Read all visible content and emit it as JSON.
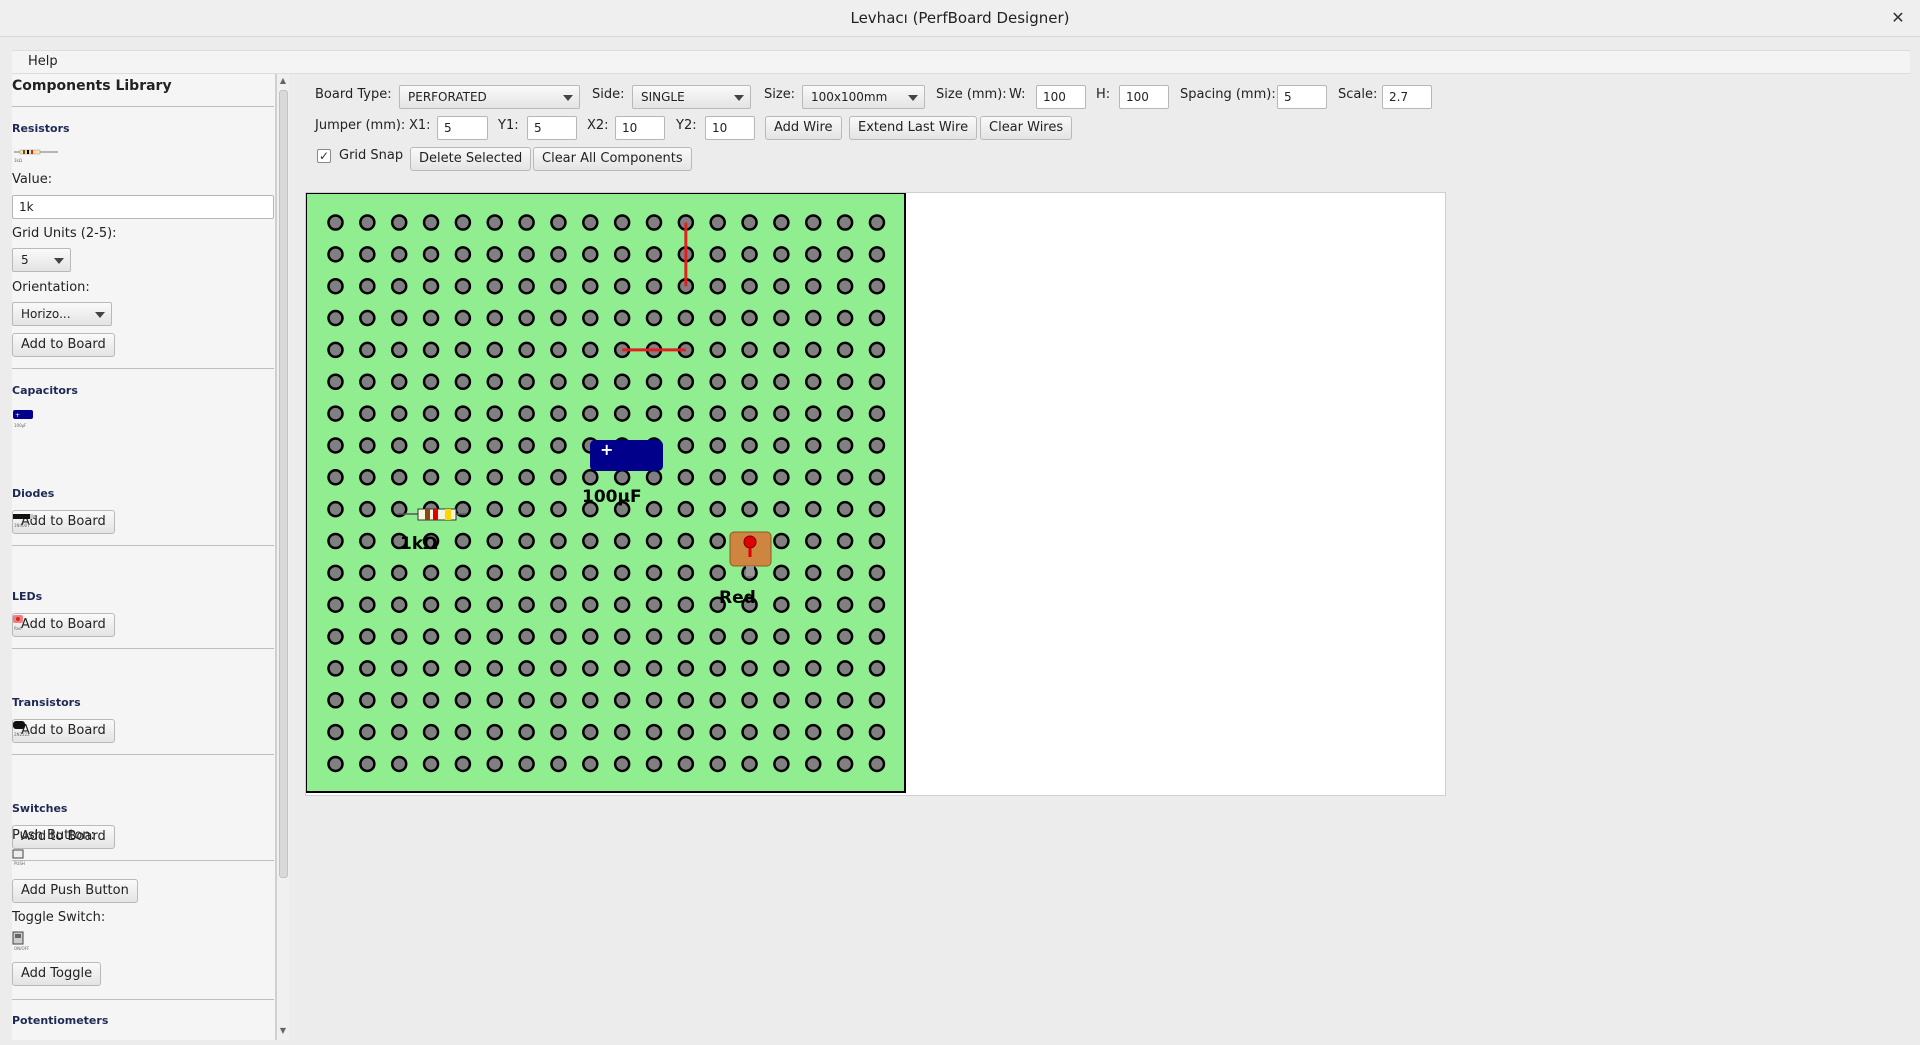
{
  "window": {
    "title": "Levhacı (PerfBoard Designer)"
  },
  "menu": {
    "help": "Help"
  },
  "sidebar": {
    "title": "Components Library",
    "resistors": {
      "title": "Resistors",
      "thumb_caption": "1kΩ",
      "value_label": "Value:",
      "value": "1k",
      "grid_label": "Grid Units (2-5):",
      "grid_value": "5",
      "orientation_label": "Orientation:",
      "orientation_value": "Horizo...",
      "add": "Add to Board"
    },
    "capacitors": {
      "title": "Capacitors",
      "thumb_caption": "100µF",
      "add": "Add to Board"
    },
    "diodes": {
      "title": "Diodes",
      "thumb_caption": "1N4007",
      "add": "Add to Board"
    },
    "leds": {
      "title": "LEDs",
      "thumb_caption": "Red",
      "add": "Add to Board"
    },
    "transistors": {
      "title": "Transistors",
      "thumb_caption": "2N2222",
      "add": "Add to Board"
    },
    "switches": {
      "title": "Switches",
      "push_label": "Push Button:",
      "push_caption": "PUSH",
      "push_add": "Add Push Button",
      "toggle_label": "Toggle Switch:",
      "toggle_caption": "ON/OFF",
      "toggle_add": "Add Toggle"
    },
    "potentiometers": {
      "title": "Potentiometers"
    }
  },
  "toolbar": {
    "board_type_label": "Board Type:",
    "board_type": "PERFORATED",
    "side_label": "Side:",
    "side": "SINGLE",
    "size_label": "Size:",
    "size": "100x100mm",
    "size_mm_label": "Size (mm):",
    "w_label": "W:",
    "w": "100",
    "h_label": "H:",
    "h": "100",
    "spacing_label": "Spacing (mm):",
    "spacing": "5",
    "scale_label": "Scale:",
    "scale": "2.7",
    "jumper_label": "Jumper (mm):",
    "x1_label": "X1:",
    "x1": "5",
    "y1_label": "Y1:",
    "y1": "5",
    "x2_label": "X2:",
    "x2": "10",
    "y2_label": "Y2:",
    "y2": "10",
    "add_wire": "Add Wire",
    "extend_wire": "Extend Last Wire",
    "clear_wires": "Clear Wires",
    "grid_snap_label": "Grid Snap",
    "grid_snap_checked": true,
    "delete_selected": "Delete Selected",
    "clear_all": "Clear All Components"
  },
  "board": {
    "color": "#90ee90",
    "hole_color": "#808080",
    "wire_color": "#e02020",
    "grid": {
      "cols": 18,
      "rows": 18
    },
    "wires": [
      {
        "from": [
          11,
          0
        ],
        "to": [
          11,
          2
        ]
      },
      {
        "from": [
          9,
          4
        ],
        "to": [
          11,
          4
        ]
      }
    ],
    "components": [
      {
        "type": "capacitor",
        "label": "100µF",
        "color": "#00008b"
      },
      {
        "type": "resistor",
        "label": "1kΩ"
      },
      {
        "type": "led",
        "label": "Red",
        "color": "#cd853f"
      }
    ]
  }
}
